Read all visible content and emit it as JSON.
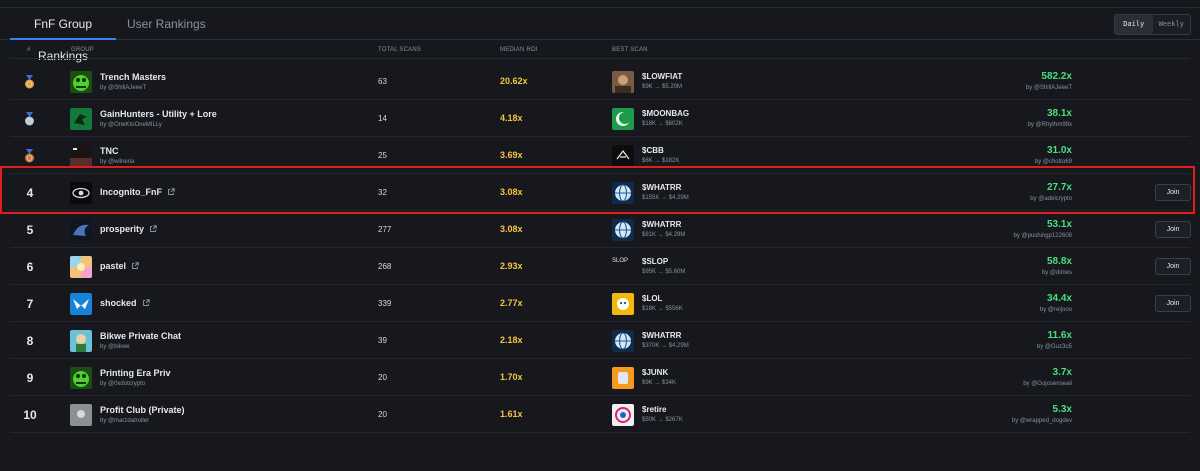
{
  "tabs": [
    {
      "label": "FnF Group Rankings"
    },
    {
      "label": "User Rankings"
    }
  ],
  "period_toggle": {
    "daily": "Daily",
    "weekly": "Weekly",
    "selected": "daily"
  },
  "columns": {
    "rank": "#",
    "group": "GROUP",
    "total_scans": "TOTAL SCANS",
    "median_roi": "MEDIAN ROI",
    "best_scan": "BEST SCAN"
  },
  "join_label": "Join",
  "rows": [
    {
      "rank": "1",
      "medal": "gold",
      "group": "Trench Masters",
      "by": "by @ShillAJeeeT",
      "scans": "63",
      "roi": "20.62x",
      "ticker": "$LOWFIAT",
      "mc": "$9K → $5.20M",
      "mult": "582.2x",
      "mby": "by @ShillAJeeeT",
      "external": false,
      "join": false,
      "avatar": "green-frog",
      "thumb": "brown-photo"
    },
    {
      "rank": "2",
      "medal": "silver",
      "group": "GainHunters - Utility + Lore",
      "by": "by @OneKtoOneMILLy",
      "scans": "14",
      "roi": "4.18x",
      "ticker": "$MOONBAG",
      "mc": "$18K → $602K",
      "mult": "38.1x",
      "mby": "by @Rhythm99x",
      "external": false,
      "join": false,
      "avatar": "green-bird",
      "thumb": "green-moon"
    },
    {
      "rank": "3",
      "medal": "bronze",
      "group": "TNC",
      "by": "by @wilneria",
      "scans": "25",
      "roi": "3.69x",
      "ticker": "$CBB",
      "mc": "$6K → $182K",
      "mult": "31.0x",
      "mby": "by @chotto69",
      "external": false,
      "join": false,
      "avatar": "dark-scene",
      "thumb": "dark-mark"
    },
    {
      "rank": "4",
      "medal": "",
      "group": "Incognito_FnF",
      "by": "",
      "scans": "32",
      "roi": "3.08x",
      "ticker": "$WHATRR",
      "mc": "$155K → $4.29M",
      "mult": "27.7x",
      "mby": "by @adelcrypto",
      "external": true,
      "join": true,
      "avatar": "eye",
      "thumb": "globe"
    },
    {
      "rank": "5",
      "medal": "",
      "group": "prosperity",
      "by": "",
      "scans": "277",
      "roi": "3.08x",
      "ticker": "$WHATRR",
      "mc": "$81K → $4.29M",
      "mult": "53.1x",
      "mby": "by @pushingp122608",
      "external": true,
      "join": true,
      "avatar": "blue-swirl",
      "thumb": "globe"
    },
    {
      "rank": "6",
      "medal": "",
      "group": "pastel",
      "by": "",
      "scans": "268",
      "roi": "2.93x",
      "ticker": "$SLOP",
      "mc": "$95K → $5.60M",
      "mult": "58.8x",
      "mby": "by @dimes",
      "external": true,
      "join": true,
      "avatar": "pastel",
      "thumb": "slop",
      "thumb_text": "SLOP"
    },
    {
      "rank": "7",
      "medal": "",
      "group": "shocked",
      "by": "",
      "scans": "339",
      "roi": "2.77x",
      "ticker": "$LOL",
      "mc": "$18K → $556K",
      "mult": "34.4x",
      "mby": "by @reljooo",
      "external": true,
      "join": true,
      "avatar": "blue-bolt",
      "thumb": "yellow-face"
    },
    {
      "rank": "8",
      "medal": "",
      "group": "Bikwe Private Chat",
      "by": "by @bikwe",
      "scans": "39",
      "roi": "2.18x",
      "ticker": "$WHATRR",
      "mc": "$370K → $4.29M",
      "mult": "11.6x",
      "mby": "by @Guz3o5",
      "external": false,
      "join": false,
      "avatar": "cartoon",
      "thumb": "globe"
    },
    {
      "rank": "9",
      "medal": "",
      "group": "Printing Era Priv",
      "by": "by @0xdotcrypto",
      "scans": "20",
      "roi": "1.70x",
      "ticker": "$JUNK",
      "mc": "$9K → $34K",
      "mult": "3.7x",
      "mby": "by @Gojosenseaii",
      "external": false,
      "join": false,
      "avatar": "green-frog",
      "thumb": "orange-junk"
    },
    {
      "rank": "10",
      "medal": "",
      "group": "Profit Club (Private)",
      "by": "by @marzdatroller",
      "scans": "20",
      "roi": "1.61x",
      "ticker": "$retire",
      "mc": "$50K → $267K",
      "mult": "5.3x",
      "mby": "by @wrapped_dogdev",
      "external": false,
      "join": false,
      "avatar": "grey-logo",
      "thumb": "retire"
    }
  ]
}
